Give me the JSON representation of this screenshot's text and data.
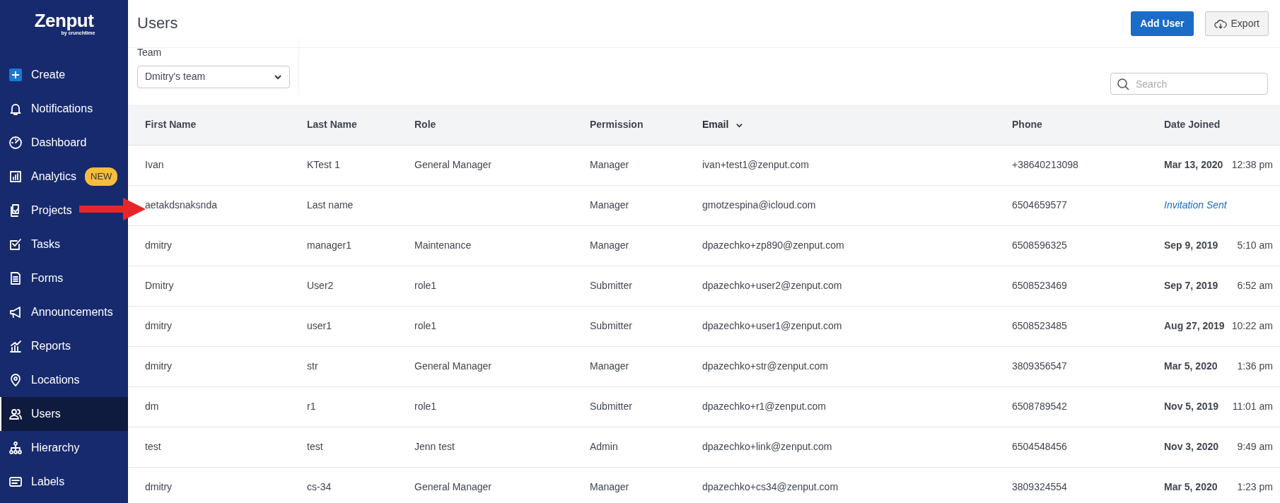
{
  "sidebar": {
    "logo": "Zenput",
    "logo_sub": "by crunchtime",
    "items": [
      {
        "label": "Create",
        "selected": false
      },
      {
        "label": "Notifications",
        "selected": false
      },
      {
        "label": "Dashboard",
        "selected": false
      },
      {
        "label": "Analytics",
        "selected": false,
        "badge": "NEW"
      },
      {
        "label": "Projects",
        "selected": false
      },
      {
        "label": "Tasks",
        "selected": false
      },
      {
        "label": "Forms",
        "selected": false
      },
      {
        "label": "Announcements",
        "selected": false
      },
      {
        "label": "Reports",
        "selected": false
      },
      {
        "label": "Locations",
        "selected": false
      },
      {
        "label": "Users",
        "selected": true
      },
      {
        "label": "Hierarchy",
        "selected": false
      },
      {
        "label": "Labels",
        "selected": false
      }
    ]
  },
  "page": {
    "title": "Users",
    "buttons": [
      {
        "label": "Add User",
        "kind": "primary"
      },
      {
        "label": "Export",
        "kind": "export"
      }
    ]
  },
  "filters": {
    "team_label": "Team",
    "team_value": "Dmitry's team",
    "search": {
      "placeholder": "Search"
    }
  },
  "table": {
    "columns": [
      {
        "label": "First Name",
        "sorted": false
      },
      {
        "label": "Last Name",
        "sorted": false
      },
      {
        "label": "Role",
        "sorted": false
      },
      {
        "label": "Permission",
        "sorted": false
      },
      {
        "label": "Email",
        "sorted": true
      },
      {
        "label": "Phone",
        "sorted": false
      },
      {
        "label": "Date Joined",
        "sorted": false
      }
    ],
    "rows": [
      {
        "first": "Ivan",
        "last": "KTest 1",
        "role": "General Manager",
        "permission": "Manager",
        "email": "ivan+test1@zenput.com",
        "phone": "+38640213098",
        "kind": "joined",
        "date": "Mar 13, 2020",
        "time": "12:38 pm"
      },
      {
        "first": "aetakdsnaksnda",
        "last": "Last name",
        "role": "",
        "permission": "Manager",
        "email": "gmotzespina@icloud.com",
        "phone": "6504659577",
        "kind": "invited",
        "status": "Invitation Sent"
      },
      {
        "first": "dmitry",
        "last": "manager1",
        "role": "Maintenance",
        "permission": "Manager",
        "email": "dpazechko+zp890@zenput.com",
        "phone": "6508596325",
        "kind": "joined",
        "date": "Sep 9, 2019",
        "time": "5:10 am"
      },
      {
        "first": "Dmitry",
        "last": "User2",
        "role": "role1",
        "permission": "Submitter",
        "email": "dpazechko+user2@zenput.com",
        "phone": "6508523469",
        "kind": "joined",
        "date": "Sep 7, 2019",
        "time": "6:52 am"
      },
      {
        "first": "dmitry",
        "last": "user1",
        "role": "role1",
        "permission": "Submitter",
        "email": "dpazechko+user1@zenput.com",
        "phone": "6508523485",
        "kind": "joined",
        "date": "Aug 27, 2019",
        "time": "10:22 am"
      },
      {
        "first": "dmitry",
        "last": "str",
        "role": "General Manager",
        "permission": "Manager",
        "email": "dpazechko+str@zenput.com",
        "phone": "3809356547",
        "kind": "joined",
        "date": "Mar 5, 2020",
        "time": "1:36 pm"
      },
      {
        "first": "dm",
        "last": "r1",
        "role": "role1",
        "permission": "Submitter",
        "email": "dpazechko+r1@zenput.com",
        "phone": "6508789542",
        "kind": "joined",
        "date": "Nov 5, 2019",
        "time": "11:01 am"
      },
      {
        "first": "test",
        "last": "test",
        "role": "Jenn test",
        "permission": "Admin",
        "email": "dpazechko+link@zenput.com",
        "phone": "6504548456",
        "kind": "joined",
        "date": "Nov 3, 2020",
        "time": "9:49 am"
      },
      {
        "first": "dmitry",
        "last": "cs-34",
        "role": "General Manager",
        "permission": "Manager",
        "email": "dpazechko+cs34@zenput.com",
        "phone": "3809324554",
        "kind": "joined",
        "date": "Mar 5, 2020",
        "time": "1:23 pm"
      }
    ]
  },
  "annotation": {
    "kind": "arrow"
  }
}
